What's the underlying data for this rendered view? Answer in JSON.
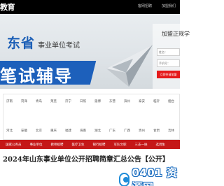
{
  "header": {
    "logo": "教育",
    "links": [
      "客网招聘",
      "加盟我们"
    ]
  },
  "banner": {
    "province": "东省",
    "subtitle": "事业单位考试",
    "headline": "笔试辅导"
  },
  "form": {
    "title": "加盟正规学",
    "name_placeholder": "姓名：",
    "phone_placeholder": "手机号：",
    "submit_label": "立即申请加盟"
  },
  "regions": {
    "row1": [
      "济南",
      "菏泽",
      "青岛",
      "莱芜",
      "济宁",
      "日照",
      "淄博",
      "东营",
      "滨州",
      "泰安",
      "临沂",
      "烟台"
    ],
    "row2": [
      "河北",
      "安徽",
      "北京",
      "重庆",
      "福建",
      "海南",
      "湖北",
      "广东",
      "广西",
      "贵州",
      "甘肃",
      "吉林",
      "江苏"
    ]
  },
  "nav": {
    "items": [
      "国家公务员",
      "事业单位",
      "教师招聘",
      "医疗卫生",
      "银行招聘",
      "军队文职",
      "三支一扶",
      "选调生"
    ]
  },
  "article": {
    "headline": "2024年山东事业单位公开招聘简章汇总公告【公开】"
  },
  "watermark": {
    "text": "0401 资源网",
    "icon": "globe-icon"
  },
  "colors": {
    "accent_red": "#c51717",
    "banner_blue": "#1d60bb",
    "header_black": "#000000"
  }
}
